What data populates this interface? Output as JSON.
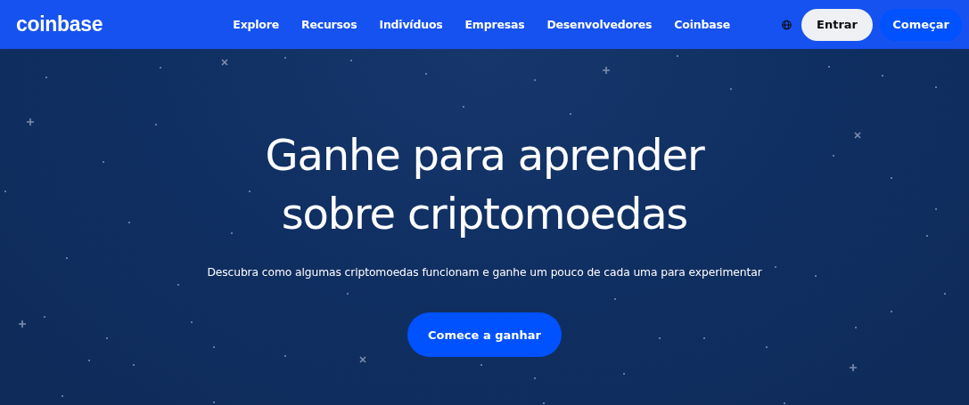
{
  "header": {
    "logo": "coinbase",
    "nav": [
      "Explore",
      "Recursos",
      "Indivíduos",
      "Empresas",
      "Desenvolvedores",
      "Coinbase"
    ],
    "sign_in": "Entrar",
    "sign_up": "Começar"
  },
  "hero": {
    "title_lines": [
      "Ganhe para aprender",
      "sobre criptomoedas"
    ],
    "subtitle": "Descubra como algumas criptomoedas funcionam e ganhe um pouco de cada uma para experimentar",
    "button": "Comece a ganhar"
  }
}
